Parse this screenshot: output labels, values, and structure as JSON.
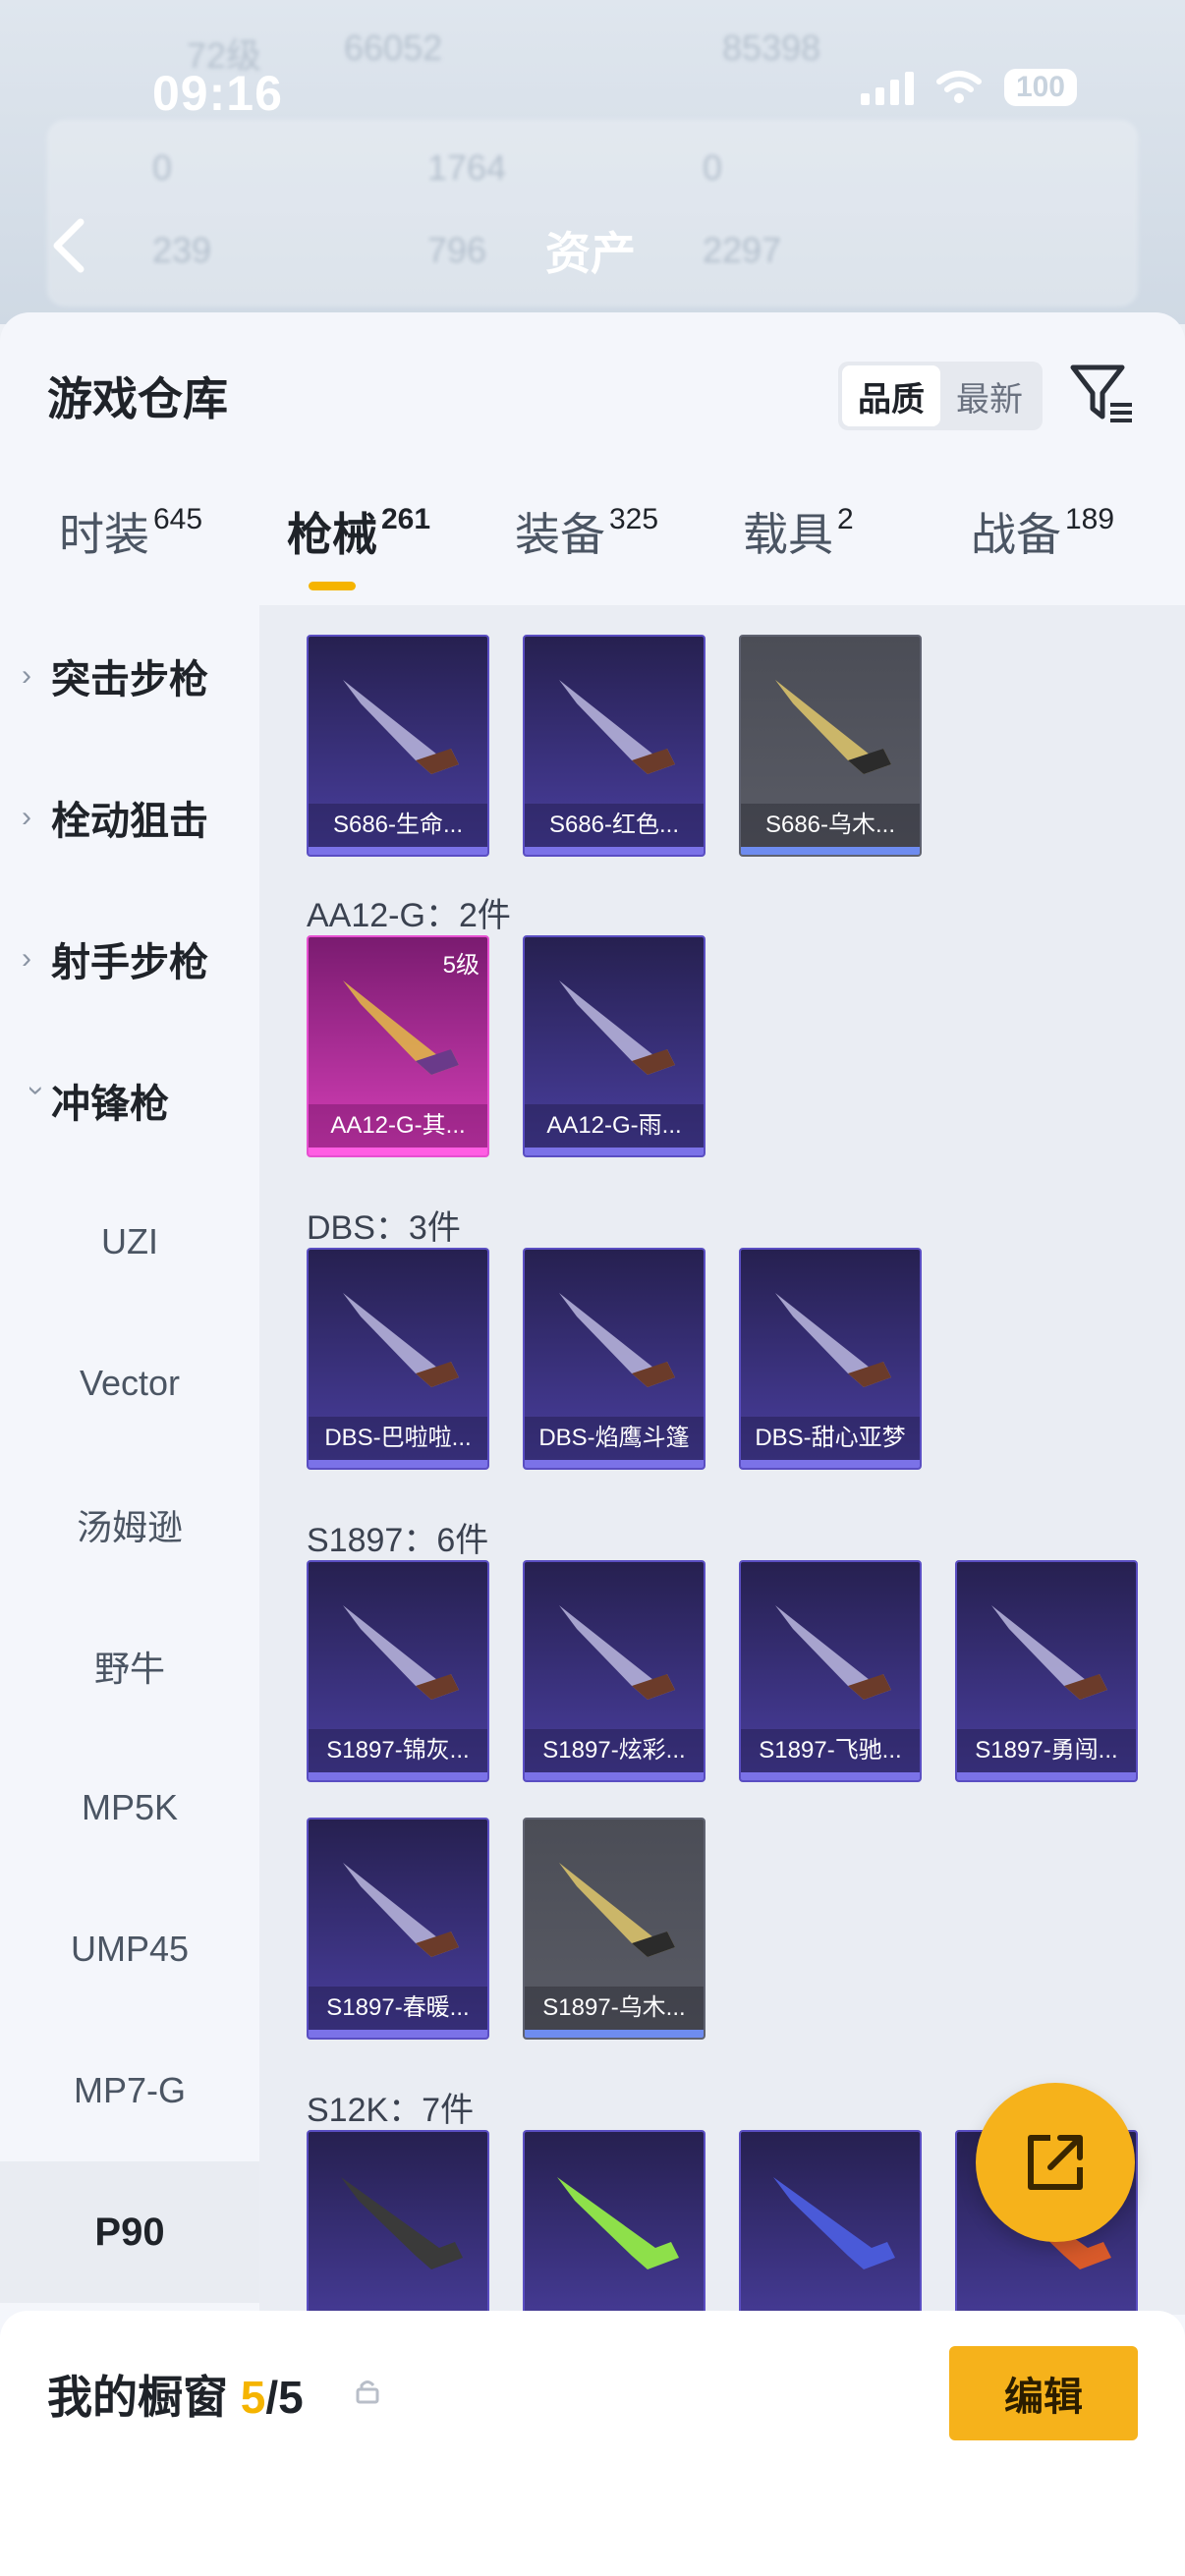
{
  "status": {
    "time": "09:16",
    "battery": "100"
  },
  "background": {
    "title": "资产",
    "level": "72级",
    "coins": "66052",
    "score": "85398",
    "v1": "0",
    "v2": "1764",
    "v3": "0",
    "v4": "239",
    "v5": "796",
    "v6": "2297"
  },
  "sheet": {
    "title": "游戏仓库",
    "sort_options": [
      "品质",
      "最新"
    ],
    "sort_active": "品质"
  },
  "tabs": [
    {
      "label": "时装",
      "count": "645"
    },
    {
      "label": "枪械",
      "count": "261"
    },
    {
      "label": "装备",
      "count": "325"
    },
    {
      "label": "载具",
      "count": "2"
    },
    {
      "label": "战备",
      "count": "189"
    }
  ],
  "categories": [
    "突击步枪",
    "栓动狙击",
    "射手步枪",
    "冲锋枪"
  ],
  "subcategories": [
    "UZI",
    "Vector",
    "汤姆逊",
    "野牛",
    "MP5K",
    "UMP45",
    "MP7-G",
    "P90"
  ],
  "selected_subcategory": "P90",
  "groups": [
    {
      "label": "",
      "items": [
        {
          "name": "S686-生命...",
          "tier": "purple"
        },
        {
          "name": "S686-红色...",
          "tier": "purple"
        },
        {
          "name": "S686-乌木...",
          "tier": "gray"
        }
      ]
    },
    {
      "label": "AA12-G：2件",
      "items": [
        {
          "name": "AA12-G-其...",
          "tier": "pink",
          "level": "5级"
        },
        {
          "name": "AA12-G-雨...",
          "tier": "purple"
        }
      ]
    },
    {
      "label": "DBS：3件",
      "items": [
        {
          "name": "DBS-巴啦啦...",
          "tier": "purple"
        },
        {
          "name": "DBS-焰鹰斗篷",
          "tier": "purple"
        },
        {
          "name": "DBS-甜心亚梦",
          "tier": "purple"
        }
      ]
    },
    {
      "label": "S1897：6件",
      "items": [
        {
          "name": "S1897-锦灰...",
          "tier": "purple"
        },
        {
          "name": "S1897-炫彩...",
          "tier": "purple"
        },
        {
          "name": "S1897-飞驰...",
          "tier": "purple"
        },
        {
          "name": "S1897-勇闯...",
          "tier": "purple"
        },
        {
          "name": "S1897-春暖...",
          "tier": "purple"
        },
        {
          "name": "S1897-乌木...",
          "tier": "gray"
        }
      ]
    },
    {
      "label": "S12K：7件",
      "items": []
    }
  ],
  "colors": {
    "accent": "#f5b400",
    "purple_tier": "#5a4ec2",
    "pink_tier": "#e64fd0"
  },
  "bottom": {
    "title": "我的橱窗",
    "current": "5",
    "total": "/5",
    "edit_label": "编辑"
  }
}
